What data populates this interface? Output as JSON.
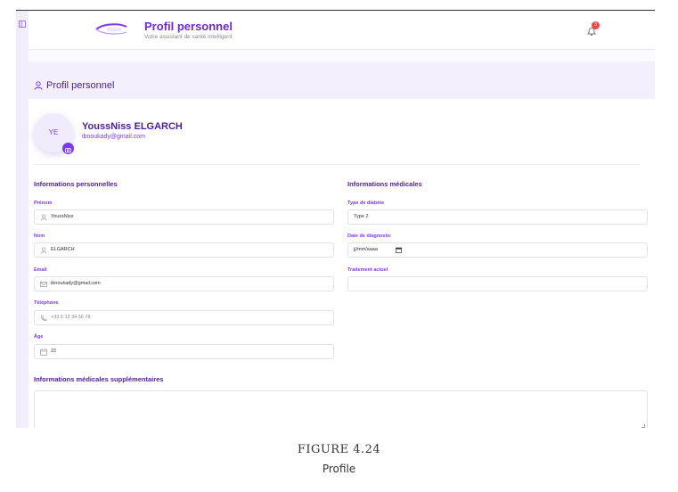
{
  "header": {
    "title": "Profil personnel",
    "subtitle": "Votre assistant de santé intelligent",
    "notification_count": "3"
  },
  "card": {
    "title": "Profil personnel"
  },
  "profile": {
    "initials": "YE",
    "name": "YoussNiss ELGARCH",
    "email": "ibnoukady@gmail.com"
  },
  "personal": {
    "section_title": "Informations personnelles",
    "prenom_label": "Prénom",
    "prenom_value": "YoussNiss",
    "nom_label": "Nom",
    "nom_value": "ELGARCH",
    "email_label": "Email",
    "email_value": "ibnoukady@gmail.com",
    "telephone_label": "Téléphone",
    "telephone_placeholder": "+33 6 12 34 56 78",
    "age_label": "Âge",
    "age_value": "22"
  },
  "medical": {
    "section_title": "Informations médicales",
    "diabetes_type_label": "Type de diabète",
    "diabetes_type_value": "Type 2",
    "diagnosis_date_label": "Date de diagnostic",
    "diagnosis_date_placeholder": "jj/mm/aaaa",
    "treatment_label": "Traitement actuel",
    "treatment_value": ""
  },
  "extra": {
    "section_title": "Informations médicales supplémentaires",
    "value": ""
  },
  "caption": {
    "figure": "FIGURE 4.24",
    "text": "Profile"
  },
  "colors": {
    "accent": "#7c3aed",
    "accent_dark": "#4c1d95",
    "header_tint": "#f3effd",
    "badge": "#ef4444"
  }
}
